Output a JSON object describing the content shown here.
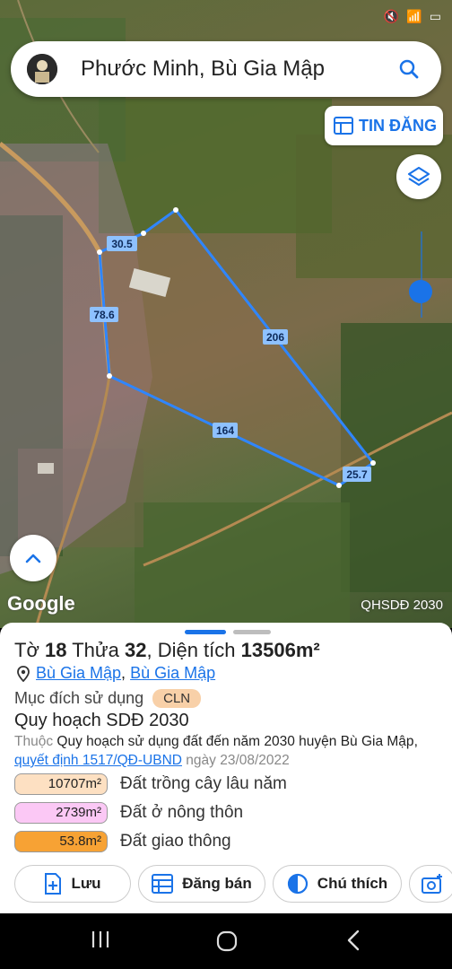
{
  "search": {
    "query": "Phước Minh, Bù Gia Mập"
  },
  "map": {
    "tin_dang_label": "TIN ĐĂNG",
    "edges": [
      "30.5",
      "78.6",
      "206",
      "164",
      "25.7"
    ],
    "google_label": "Google",
    "layer_label": "QHSDĐ 2030"
  },
  "parcel": {
    "to_label": "Tờ",
    "to": "18",
    "thua_label": "Thửa",
    "thua": "32",
    "dientich_label": "Diện tích",
    "dientich": "13506m²",
    "commune": "Bù Gia Mập",
    "separator": ",",
    "district": "Bù Gia Mập",
    "purpose_label": "Mục đích sử dụng",
    "purpose_code": "CLN",
    "plan_title": "Quy hoạch SDĐ 2030",
    "plan_prefix": "Thuộc",
    "plan_name": "Quy hoạch sử dụng đất đến năm 2030 huyện Bù Gia Mập",
    "plan_comma": ",",
    "decision": "quyết định 1517/QĐ-UBND",
    "decision_date": "ngày 23/08/2022"
  },
  "legend": [
    {
      "area": "10707m²",
      "name": "Đất trồng cây lâu năm",
      "color": "#fde0c2"
    },
    {
      "area": "2739m²",
      "name": "Đất ở nông thôn",
      "color": "#fbc8f5"
    },
    {
      "area": "53.8m²",
      "name": "Đất giao thông",
      "color": "#f7a234"
    }
  ],
  "actions": {
    "save": "Lưu",
    "sell": "Đăng bán",
    "legend": "Chú thích"
  },
  "colors": {
    "accent": "#1a73e8",
    "polygon": "#2f86ff"
  }
}
